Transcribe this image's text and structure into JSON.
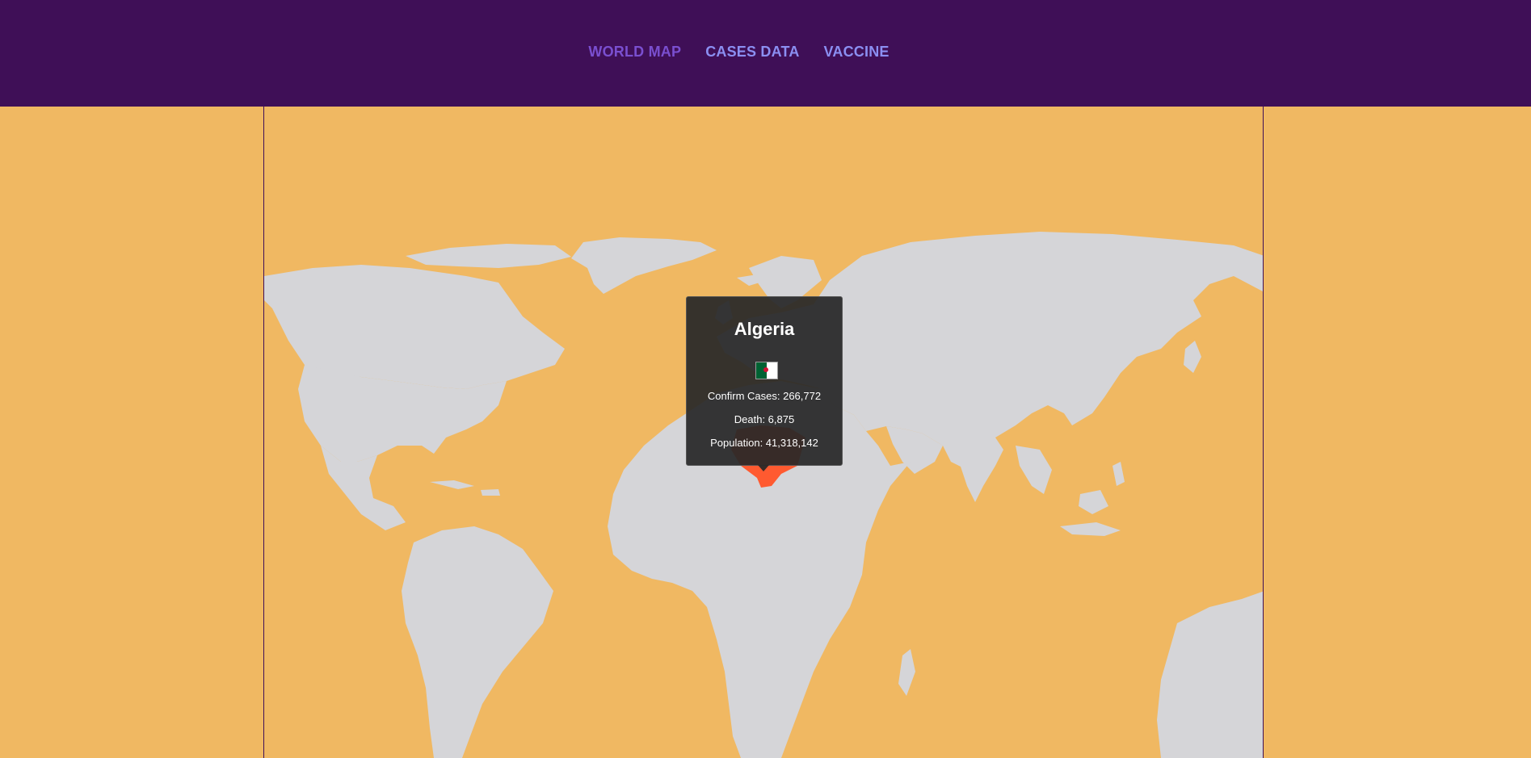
{
  "nav": {
    "items": [
      {
        "label": "WORLD MAP",
        "active": true
      },
      {
        "label": "CASES DATA",
        "active": false
      },
      {
        "label": "VACCINE",
        "active": false
      }
    ]
  },
  "colors": {
    "header": "#3f0f57",
    "ocean": "#f0b862",
    "land": "#d5d5d8",
    "highlight": "#ff5a30",
    "active_nav": "#7a4fd0",
    "nav": "#8b8ff2"
  },
  "map": {
    "selected_country": "Algeria"
  },
  "tooltip": {
    "country": "Algeria",
    "flag_icon": "algeria-flag-icon",
    "confirm_cases": "Confirm Cases: 266,772",
    "death": "Death: 6,875",
    "population": "Population: 41,318,142"
  }
}
